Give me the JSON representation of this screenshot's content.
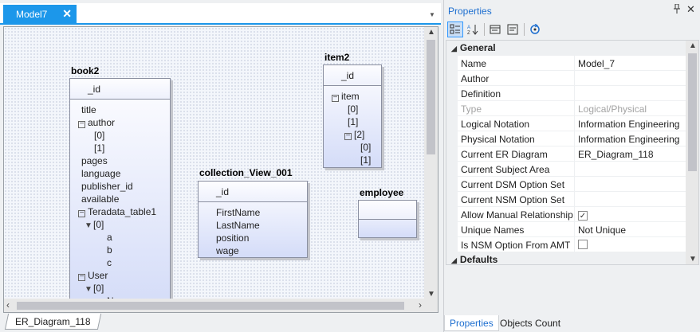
{
  "document_tab": {
    "label": "Model7",
    "close_glyph": "✕",
    "dropdown_glyph": "▼"
  },
  "diagram_tab": {
    "label": "ER_Diagram_118"
  },
  "canvas": {
    "entities": [
      {
        "title": "book2",
        "pk": "_id",
        "attributes": [
          {
            "toggle": "",
            "text": "title"
          },
          {
            "toggle": "⊟",
            "text": "author"
          },
          {
            "toggle": "",
            "text": "[0]"
          },
          {
            "toggle": "",
            "text": "[1]"
          },
          {
            "toggle": "",
            "text": "pages"
          },
          {
            "toggle": "",
            "text": "language"
          },
          {
            "toggle": "",
            "text": "publisher_id"
          },
          {
            "toggle": "",
            "text": "available"
          },
          {
            "toggle": "⊟",
            "text": "Teradata_table1"
          },
          {
            "toggle": "▼",
            "text": "[0]"
          },
          {
            "toggle": "",
            "text": "a"
          },
          {
            "toggle": "",
            "text": "b"
          },
          {
            "toggle": "",
            "text": "c"
          },
          {
            "toggle": "⊟",
            "text": "User"
          },
          {
            "toggle": "▼",
            "text": "[0]"
          },
          {
            "toggle": "",
            "text": "N"
          }
        ]
      },
      {
        "title": "item2",
        "pk": "_id",
        "attributes": [
          {
            "toggle": "⊟",
            "text": "item"
          },
          {
            "toggle": "",
            "text": "[0]"
          },
          {
            "toggle": "",
            "text": "[1]"
          },
          {
            "toggle": "⊟",
            "text": "[2]"
          },
          {
            "toggle": "",
            "text": "[0]"
          },
          {
            "toggle": "",
            "text": "[1]"
          }
        ]
      },
      {
        "title": "collection_View_001",
        "pk": "_id",
        "attributes": [
          {
            "toggle": "",
            "text": "FirstName"
          },
          {
            "toggle": "",
            "text": "LastName"
          },
          {
            "toggle": "",
            "text": "position"
          },
          {
            "toggle": "",
            "text": "wage"
          }
        ]
      },
      {
        "title": "employee",
        "pk": "",
        "attributes": []
      }
    ]
  },
  "properties": {
    "title": "Properties",
    "pin_glyph": "📌",
    "close_glyph": "✕",
    "toolbar": {
      "categorized_icon": "categorized-icon",
      "alphabetical_icon": "sort-az-icon",
      "property_pages_icon": "property-pages-icon",
      "events_icon": "events-icon",
      "refresh_icon": "refresh-icon"
    },
    "categories": [
      {
        "name": "General",
        "rows": [
          {
            "name": "Name",
            "value": "Model_7"
          },
          {
            "name": "Author",
            "value": ""
          },
          {
            "name": "Definition",
            "value": ""
          },
          {
            "name": "Type",
            "value": "Logical/Physical",
            "disabled": true
          },
          {
            "name": "Logical Notation",
            "value": "Information Engineering"
          },
          {
            "name": "Physical Notation",
            "value": "Information Engineering"
          },
          {
            "name": "Current ER Diagram",
            "value": "ER_Diagram_118"
          },
          {
            "name": "Current Subject Area",
            "value": ""
          },
          {
            "name": "Current DSM Option Set",
            "value": ""
          },
          {
            "name": "Current NSM Option Set",
            "value": ""
          },
          {
            "name": "Allow Manual Relationship",
            "value": "",
            "checkbox": true,
            "checked": true
          },
          {
            "name": "Unique Names",
            "value": "Not Unique"
          },
          {
            "name": "Is NSM Option From AMT",
            "value": "",
            "checkbox": true,
            "checked": false
          }
        ]
      },
      {
        "name": "Defaults",
        "rows": []
      }
    ],
    "bottom_tabs": [
      {
        "label": "Properties",
        "active": true
      },
      {
        "label": "Objects Count",
        "active": false
      }
    ]
  }
}
